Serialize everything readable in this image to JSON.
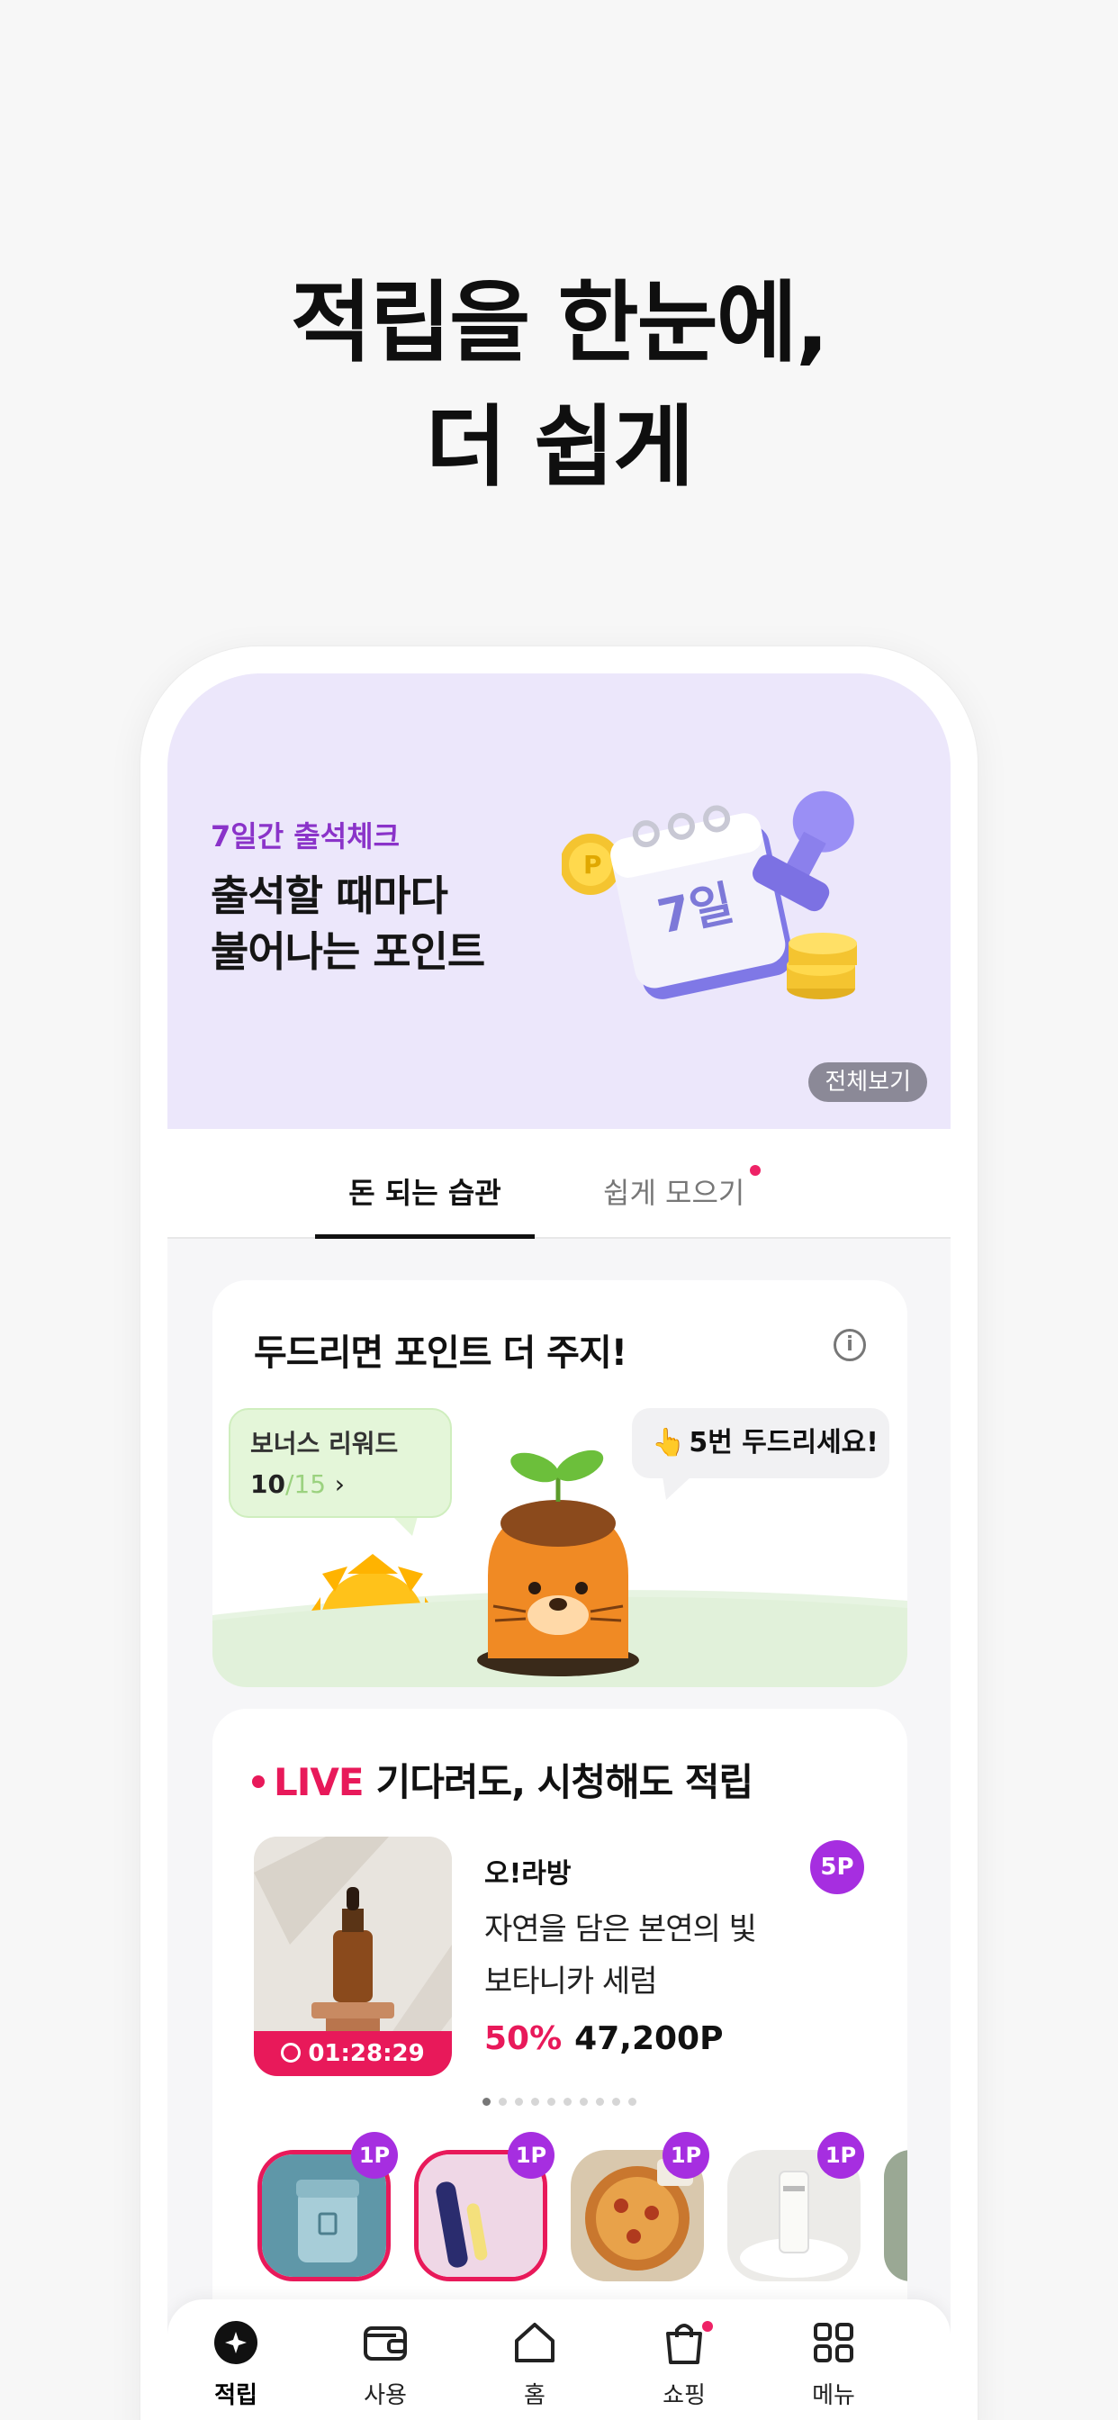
{
  "headline": {
    "line1": "적립을 한눈에,",
    "line2": "더 쉽게"
  },
  "banner": {
    "eyebrow": "7일간 출석체크",
    "title_line1": "출석할 때마다",
    "title_line2": "불어나는 포인트",
    "calendar_text": "7일",
    "view_all": "전체보기",
    "background": "#ece7fb"
  },
  "tabs": [
    {
      "label": "돈 되는 습관",
      "active": true
    },
    {
      "label": "쉽게 모으기",
      "active": false,
      "has_dot": true
    }
  ],
  "tap_card": {
    "title": "두드리면 포인트 더 주지!",
    "bonus_label": "보너스 리워드",
    "bonus_current": "10",
    "bonus_total": "/15",
    "bubble_text": "5번 두드리세요!"
  },
  "live": {
    "live_word": "LIVE",
    "headline": "기다려도, 시청해도 적립",
    "timer": "01:28:29",
    "brand": "오!라방",
    "point_badge": "5P",
    "name_line1": "자연을 담은 본연의 빛",
    "name_line2": "보타니카 세럼",
    "discount": "50%",
    "price": "47,200P",
    "page_count": 10,
    "active_page": 1,
    "thumbs": [
      {
        "badge": "1P",
        "icon": "cream-jar",
        "ring": true
      },
      {
        "badge": "1P",
        "icon": "lip-tint",
        "ring": true
      },
      {
        "badge": "1P",
        "icon": "pizza",
        "ring": false
      },
      {
        "badge": "1P",
        "icon": "tube-cream",
        "ring": false
      }
    ]
  },
  "nav": [
    {
      "label": "적립",
      "icon": "sparkle-coin-icon",
      "active": true
    },
    {
      "label": "사용",
      "icon": "wallet-icon",
      "active": false
    },
    {
      "label": "홈",
      "icon": "home-icon",
      "active": false
    },
    {
      "label": "쇼핑",
      "icon": "shopping-bag-icon",
      "active": false,
      "has_dot": true
    },
    {
      "label": "메뉴",
      "icon": "grid-menu-icon",
      "active": false
    }
  ],
  "colors": {
    "accent_pink": "#e8195a",
    "accent_purple": "#a62ee0",
    "eyebrow_purple": "#8a33c9"
  }
}
